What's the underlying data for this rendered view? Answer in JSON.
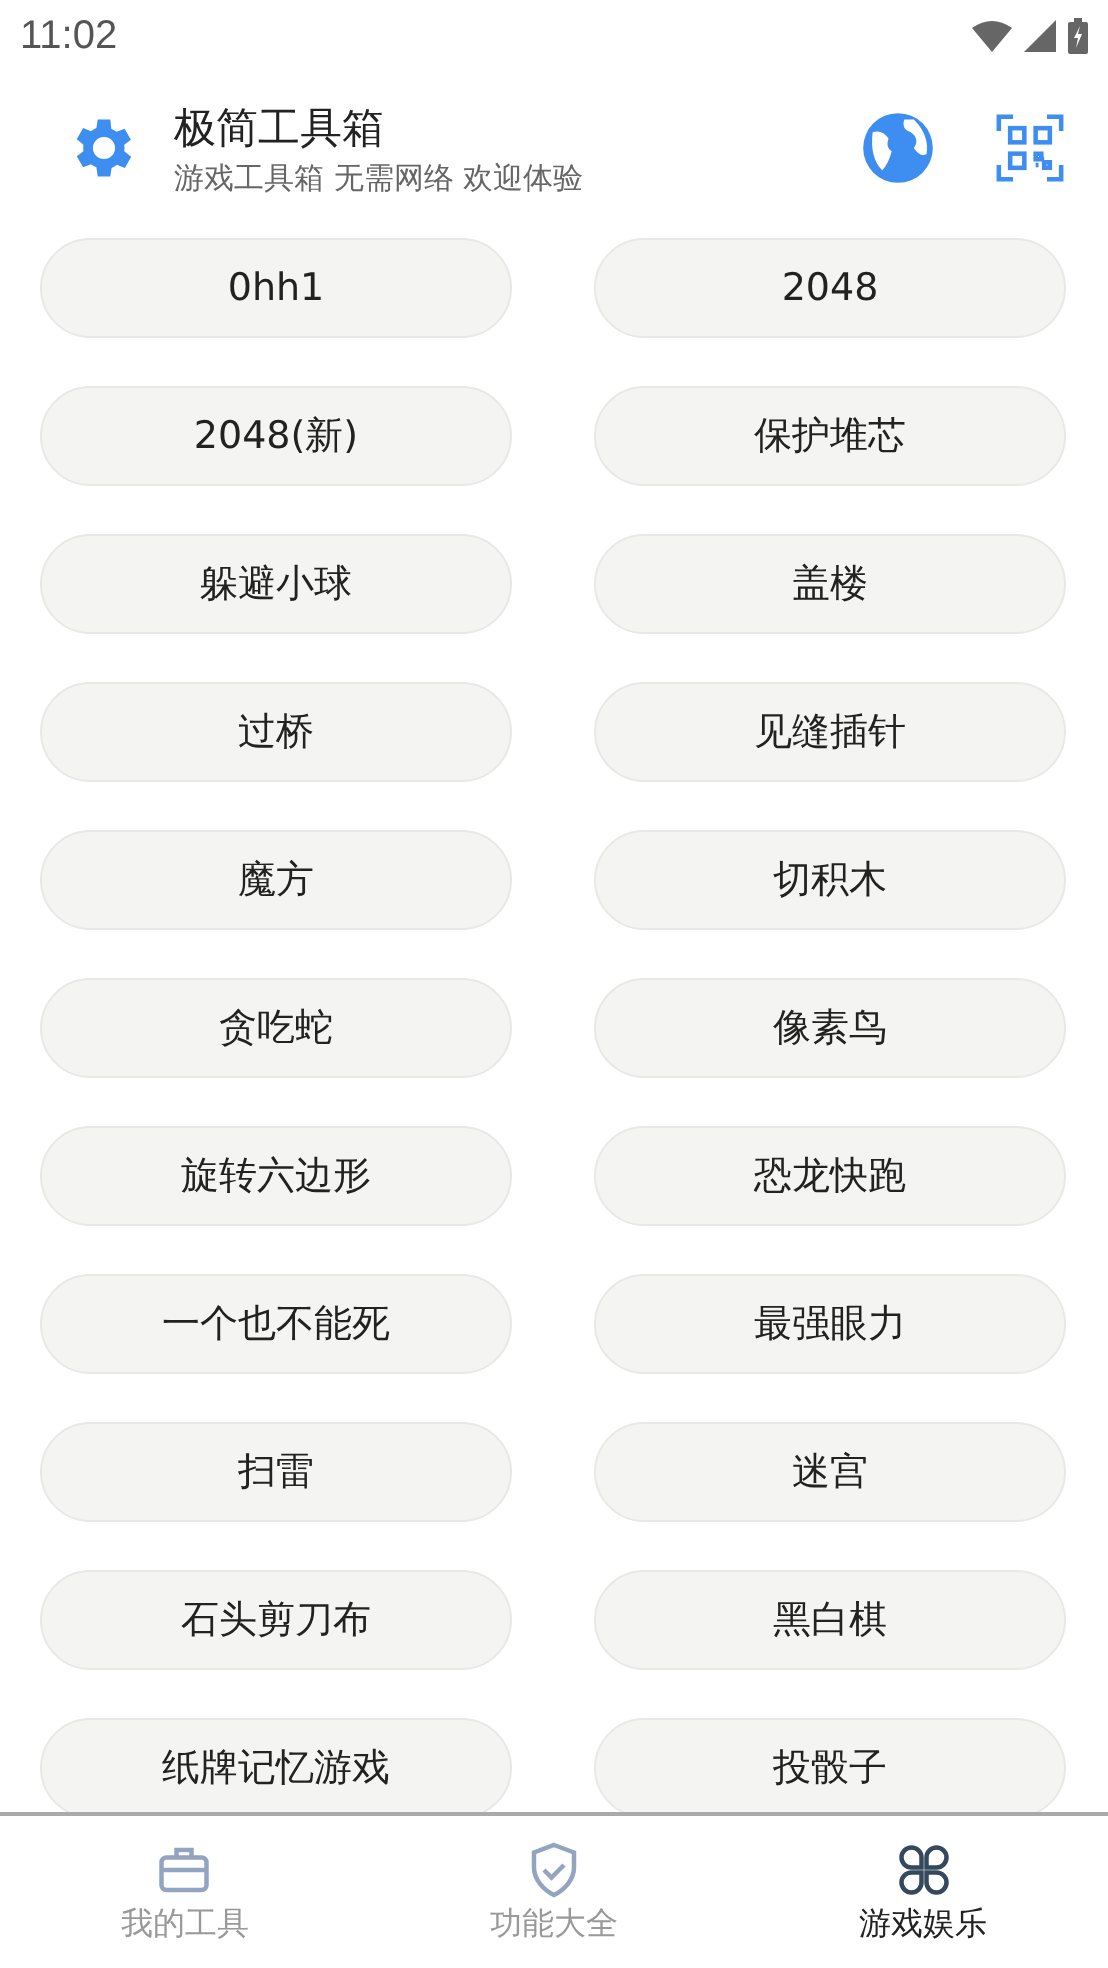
{
  "status_bar": {
    "time": "11:02"
  },
  "header": {
    "title": "极简工具箱",
    "subtitle": "游戏工具箱 无需网络 欢迎体验"
  },
  "games": [
    "0hh1",
    "2048",
    "2048(新)",
    "保护堆芯",
    "躲避小球",
    "盖楼",
    "过桥",
    "见缝插针",
    "魔方",
    "切积木",
    "贪吃蛇",
    "像素鸟",
    "旋转六边形",
    "恐龙快跑",
    "一个也不能死",
    "最强眼力",
    "扫雷",
    "迷宫",
    "石头剪刀布",
    "黑白棋",
    "纸牌记忆游戏",
    "投骰子"
  ],
  "nav": [
    {
      "label": "我的工具",
      "kind": "tools",
      "selected": false
    },
    {
      "label": "功能大全",
      "kind": "features",
      "selected": false
    },
    {
      "label": "游戏娱乐",
      "kind": "games",
      "selected": true
    }
  ]
}
